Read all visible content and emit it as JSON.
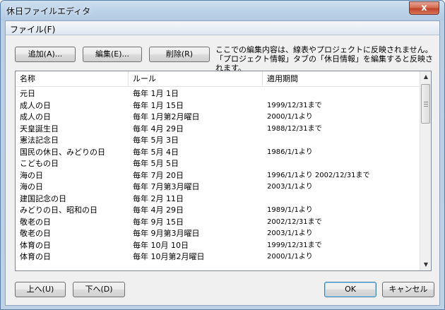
{
  "window": {
    "title": "休日ファイルエディタ",
    "close_glyph": "x"
  },
  "menu": {
    "file": "ファイル(F)"
  },
  "toolbar": {
    "add": "追加(A)...",
    "edit": "編集(E)...",
    "delete": "削除(R)"
  },
  "info": {
    "line1": "ここでの編集内容は、線表やプロジェクトに反映されません。",
    "line2": "「プロジェクト情報」タブの「休日情報」を編集すると反映されます。"
  },
  "list": {
    "columns": [
      "名称",
      "ルール",
      "適用期間"
    ],
    "rows": [
      [
        "元日",
        "毎年 1月 1日",
        ""
      ],
      [
        "成人の日",
        "毎年 1月 15日",
        "1999/12/31まで"
      ],
      [
        "成人の日",
        "毎年 1月第2月曜日",
        "2000/1/1より"
      ],
      [
        "天皇誕生日",
        "毎年 4月 29日",
        "1988/12/31まで"
      ],
      [
        "憲法記念日",
        "毎年 5月 3日",
        ""
      ],
      [
        "国民の休日、みどりの日",
        "毎年 5月 4日",
        "1986/1/1より"
      ],
      [
        "こどもの日",
        "毎年 5月 5日",
        ""
      ],
      [
        "海の日",
        "毎年 7月 20日",
        "1996/1/1より 2002/12/31まで"
      ],
      [
        "海の日",
        "毎年 7月第3月曜日",
        "2003/1/1より"
      ],
      [
        "建国記念の日",
        "毎年 2月 11日",
        ""
      ],
      [
        "みどりの日、昭和の日",
        "毎年 4月 29日",
        "1989/1/1より"
      ],
      [
        "敬老の日",
        "毎年 9月 15日",
        "2002/12/31まで"
      ],
      [
        "敬老の日",
        "毎年 9月第3月曜日",
        "2003/1/1より"
      ],
      [
        "体育の日",
        "毎年 10月 10日",
        "1999/12/31まで"
      ],
      [
        "体育の日",
        "毎年 10月第2月曜日",
        "2000/1/1より"
      ]
    ]
  },
  "footer": {
    "up": "上へ(U)",
    "down": "下へ(D)",
    "ok": "OK",
    "cancel": "キャンセル"
  }
}
